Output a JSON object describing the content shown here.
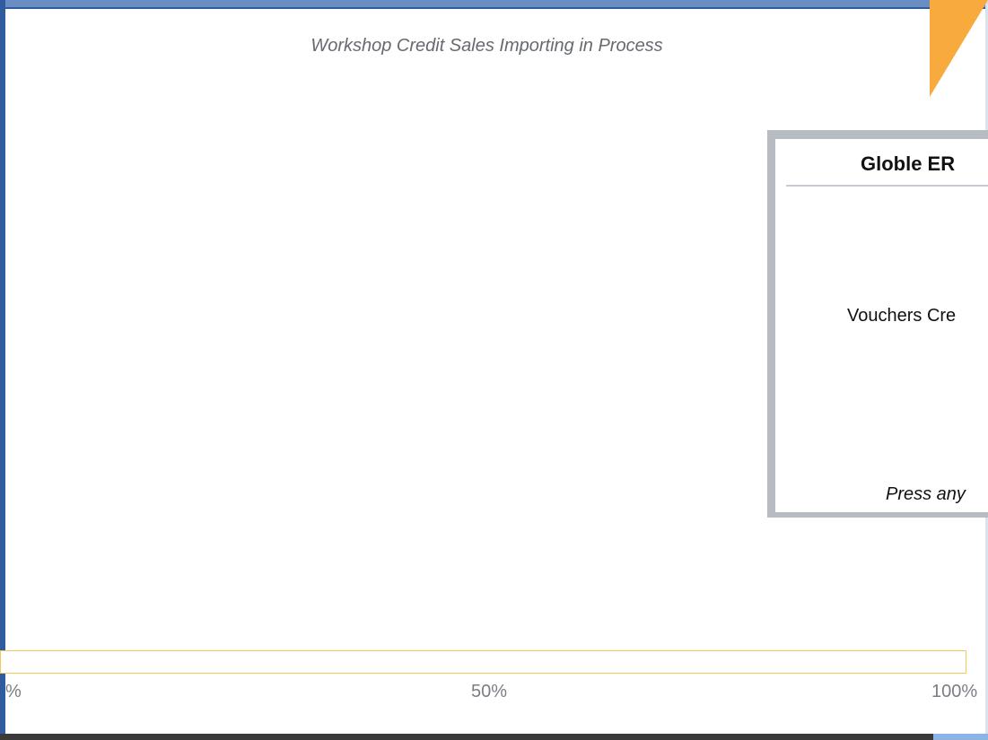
{
  "process": {
    "title": "Workshop Credit Sales Importing in Process",
    "progress_fraction": 0
  },
  "progress_scale": {
    "start": "%",
    "middle": "50%",
    "end": "100%"
  },
  "message_box": {
    "title": "Globle ER",
    "message": "Vouchers Cre",
    "hint": "Press any"
  },
  "colors": {
    "frame": "#2f5c9e",
    "accent": "#f8aa3c",
    "progress_border": "#f5c85a",
    "dialog_border": "#b7bcc2"
  }
}
